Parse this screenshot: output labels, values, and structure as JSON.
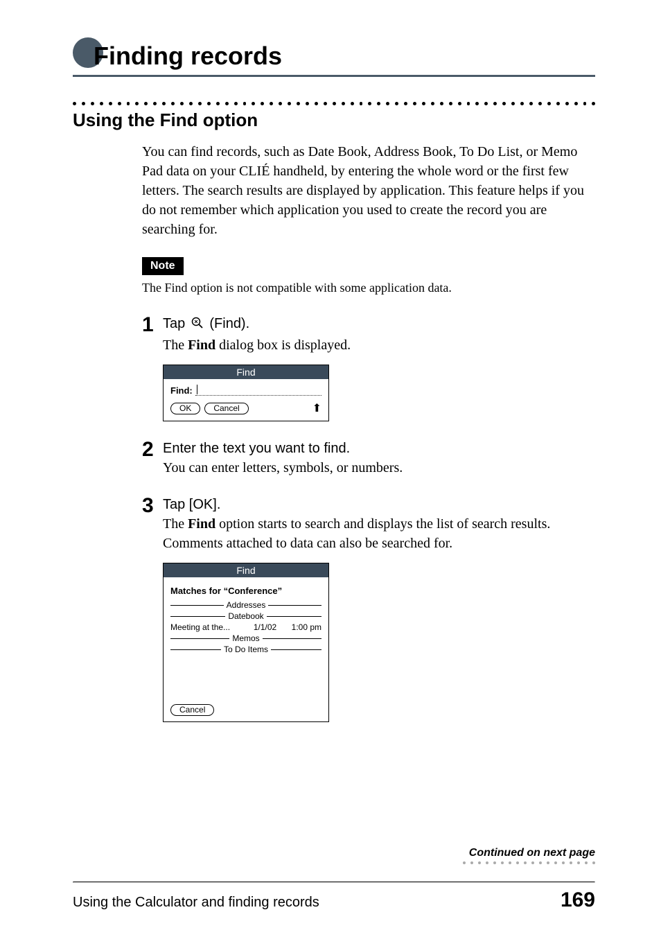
{
  "chapter": {
    "title": "Finding records"
  },
  "section": {
    "title": "Using the Find option",
    "intro": "You can find records, such as Date Book, Address Book, To Do List, or Memo Pad data on your CLIÉ handheld, by entering the whole word or the first few letters. The search results are displayed by application. This feature helps if you do not remember which application you used to create the record you are searching for."
  },
  "note": {
    "label": "Note",
    "text": "The Find option is not compatible with some application data."
  },
  "steps": [
    {
      "num": "1",
      "title_pre": "Tap ",
      "title_post": " (Find).",
      "desc_pre": "The ",
      "desc_bold": "Find",
      "desc_post": " dialog box is displayed."
    },
    {
      "num": "2",
      "title": "Enter the text you want to find.",
      "desc": "You can enter letters, symbols, or numbers."
    },
    {
      "num": "3",
      "title": "Tap [OK].",
      "desc_pre": "The ",
      "desc_bold": "Find",
      "desc_post": " option starts to search and displays the list of search results. Comments attached to data can also be searched for."
    }
  ],
  "dialog1": {
    "title": "Find",
    "find_label": "Find:",
    "ok": "OK",
    "cancel": "Cancel"
  },
  "dialog2": {
    "title": "Find",
    "matches_pre": "Matches for ",
    "matches_term": "“Conference”",
    "groups": [
      "Addresses",
      "Datebook",
      "Memos",
      "To Do Items"
    ],
    "result": {
      "text": "Meeting at the...",
      "date": "1/1/02",
      "time": "1:00 pm"
    },
    "cancel": "Cancel"
  },
  "continued": "Continued on next page",
  "footer": {
    "text": "Using the Calculator and finding records",
    "page": "169"
  }
}
